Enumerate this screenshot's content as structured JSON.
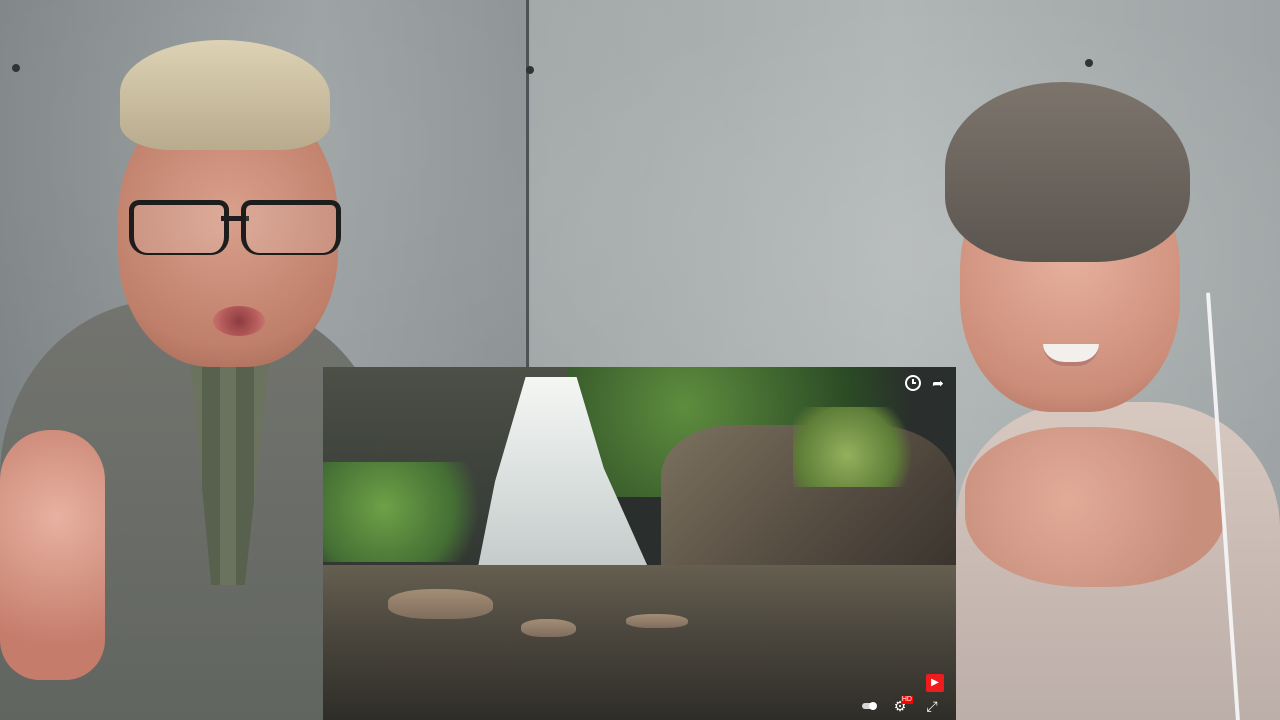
{
  "scene": {
    "wall_color": "#9ea4a5",
    "accent_red": "#ee1c1c"
  },
  "video": {
    "top_actions": {
      "watch_later_icon": "clock-icon",
      "share_icon": "share-icon",
      "share_symbol": "➦"
    },
    "channel_badge": {
      "icon": "youtube-icon",
      "symbol": "▶"
    },
    "controls": {
      "autoplay_icon": "toggle-icon",
      "settings_icon": "settings-icon",
      "settings_symbol": "⚙",
      "quality_badge": "HD",
      "fullscreen_icon": "fullscreen-icon",
      "fullscreen_symbol": "⤢"
    }
  }
}
